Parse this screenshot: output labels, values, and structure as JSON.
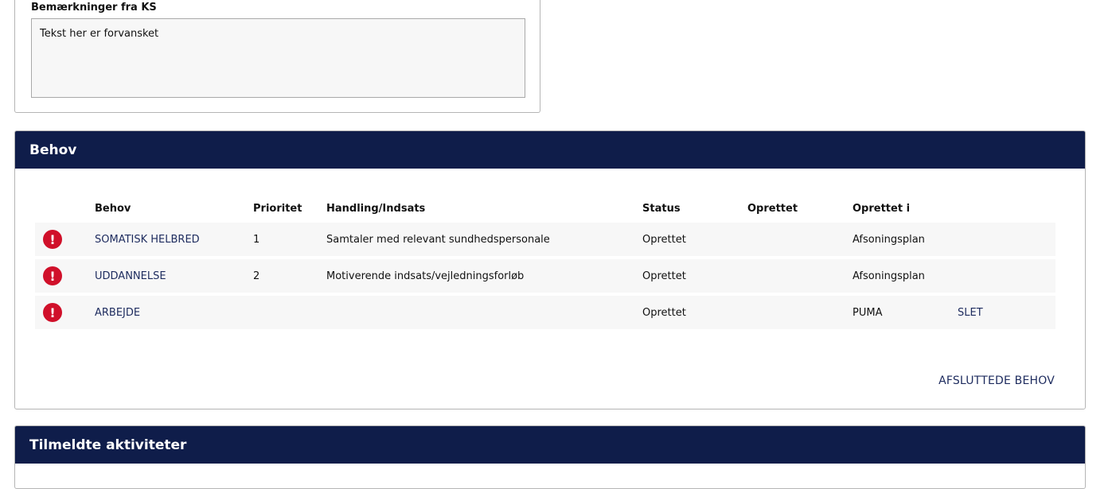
{
  "remarks": {
    "label": "Bemærkninger fra KS",
    "value": "Tekst her er forvansket"
  },
  "behov_panel": {
    "title": "Behov",
    "columns": {
      "behov": "Behov",
      "prioritet": "Prioritet",
      "handling": "Handling/Indsats",
      "status": "Status",
      "oprettet": "Oprettet",
      "oprettet_i": "Oprettet i"
    },
    "rows": [
      {
        "icon": "!",
        "behov": "SOMATISK HELBRED",
        "prioritet": "1",
        "handling": "Samtaler med relevant sundhedspersonale",
        "status": "Oprettet",
        "oprettet": "",
        "oprettet_i": "Afsoningsplan",
        "action": ""
      },
      {
        "icon": "!",
        "behov": "UDDANNELSE",
        "prioritet": "2",
        "handling": "Motiverende indsats/vejledningsforløb",
        "status": "Oprettet",
        "oprettet": "",
        "oprettet_i": "Afsoningsplan",
        "action": ""
      },
      {
        "icon": "!",
        "behov": "ARBEJDE",
        "prioritet": "",
        "handling": "",
        "status": "Oprettet",
        "oprettet": "",
        "oprettet_i": "PUMA",
        "action": "SLET"
      }
    ],
    "footer_link": "AFSLUTTEDE BEHOV"
  },
  "aktiviteter_panel": {
    "title": "Tilmeldte aktiviteter"
  },
  "colors": {
    "header_bg": "#0f1d4a",
    "link": "#1d2b5e",
    "warning": "#d0102a",
    "row_bg": "#f7f7f7"
  }
}
